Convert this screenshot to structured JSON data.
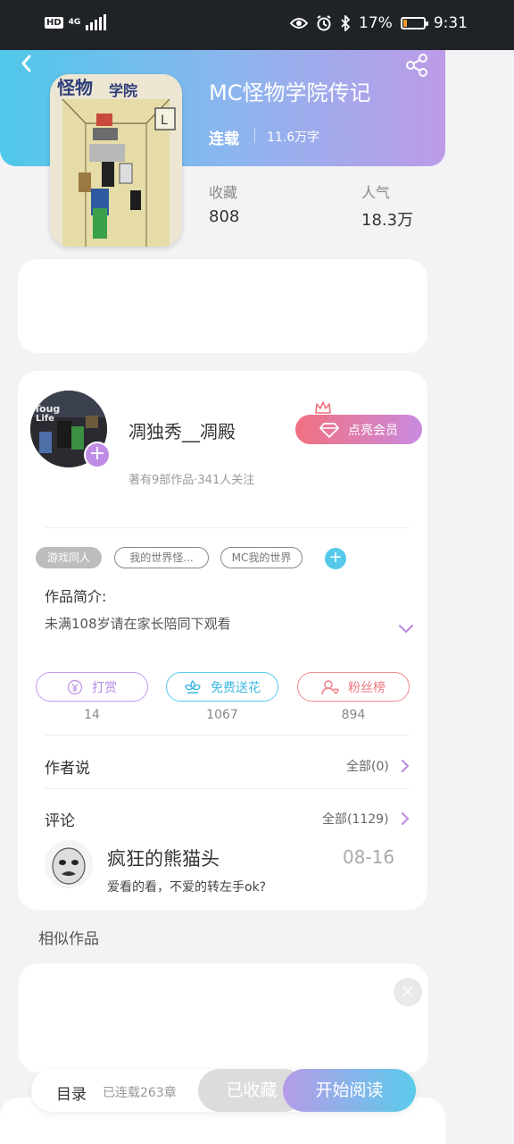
{
  "status_bar": {
    "hd": "HD",
    "network": "4G",
    "battery": "17%",
    "battery_level": 0.17,
    "time": "9:31"
  },
  "book": {
    "title": "MC怪物学院传记",
    "status": "连载",
    "word_count": "11.6万字",
    "stats": {
      "favorites_label": "收藏",
      "favorites_value": "808",
      "popularity_label": "人气",
      "popularity_value": "18.3万"
    }
  },
  "author": {
    "name": "凋独秀__凋殿",
    "subtitle": "著有9部作品·341人关注",
    "vip_button": "点亮会员"
  },
  "tags": [
    "游戏同人",
    "我的世界怪...",
    "MC我的世界"
  ],
  "intro": {
    "heading": "作品简介:",
    "text": "未满108岁请在家长陪同下观看"
  },
  "actions": {
    "reward": {
      "label": "打赏",
      "count": "14"
    },
    "flower": {
      "label": "免费送花",
      "count": "1067"
    },
    "fans": {
      "label": "粉丝榜",
      "count": "894"
    }
  },
  "author_says": {
    "title": "作者说",
    "more": "全部(0)"
  },
  "comments": {
    "title": "评论",
    "more": "全部(1129)",
    "first": {
      "name": "疯狂的熊猫头",
      "date": "08-16",
      "text": "爱看的看，不爱的转左手ok?"
    }
  },
  "similar": {
    "title": "相似作品"
  },
  "bottom_bar": {
    "toc": "目录",
    "chapters": "已连载263章",
    "collected": "已收藏",
    "start_reading": "开始阅读"
  },
  "colors": {
    "accent_purple": "#c08de6",
    "accent_blue": "#56c9eb",
    "accent_red": "#f2707f"
  }
}
